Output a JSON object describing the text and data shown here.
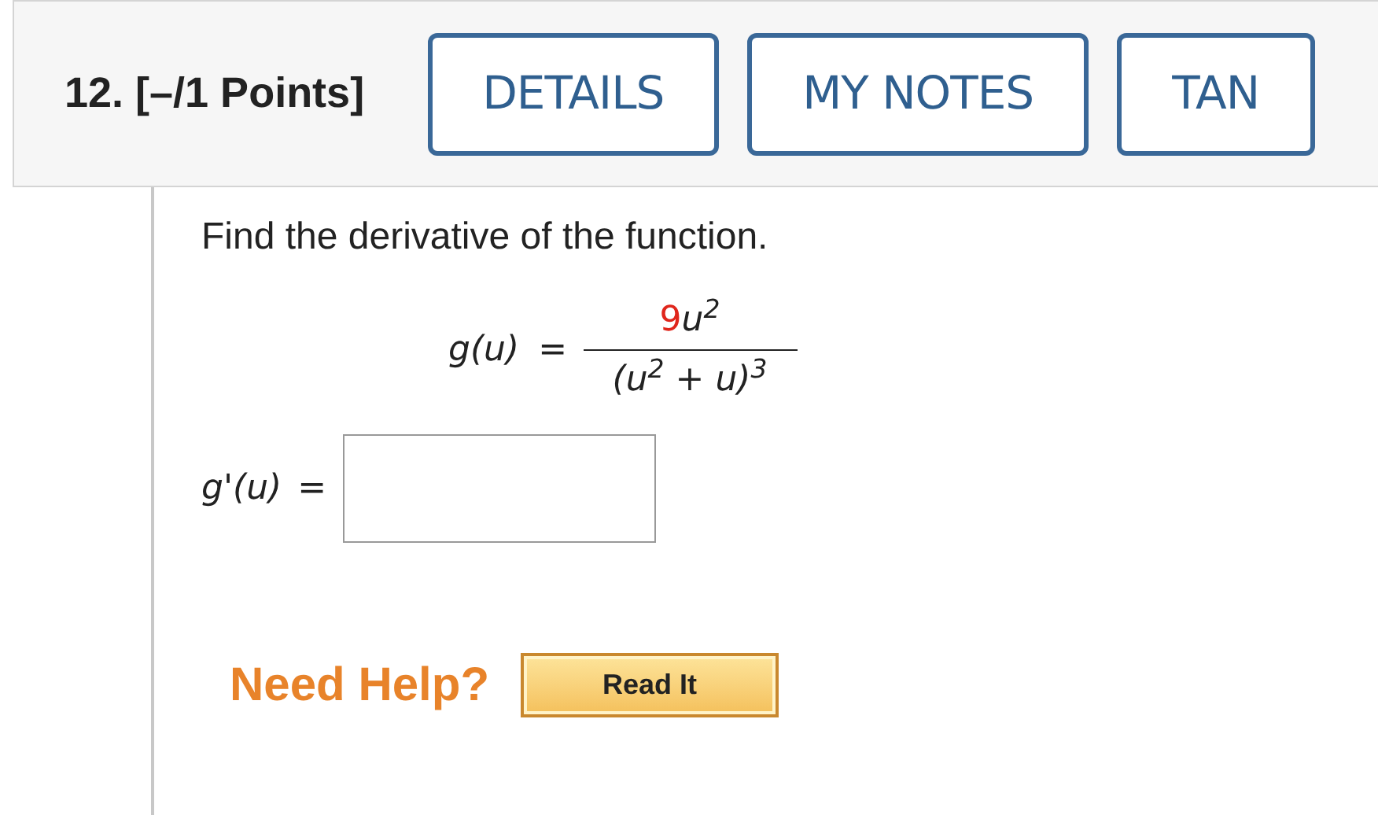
{
  "header": {
    "title": "12. [–/1 Points]",
    "buttons": [
      "DETAILS",
      "MY NOTES",
      "TAN"
    ]
  },
  "question": {
    "prompt": "Find the derivative of the function.",
    "function": {
      "lhs": "g(u)",
      "equals": "=",
      "numerator_coefficient": "9",
      "numerator_rest": "u$^{2}$",
      "denominator": "(u$^{2}$ + u)$^{3}$"
    },
    "answer": {
      "label": "g'(u)",
      "equals": "="
    }
  },
  "help": {
    "label": "Need Help?",
    "buttons": [
      "Read It"
    ]
  }
}
